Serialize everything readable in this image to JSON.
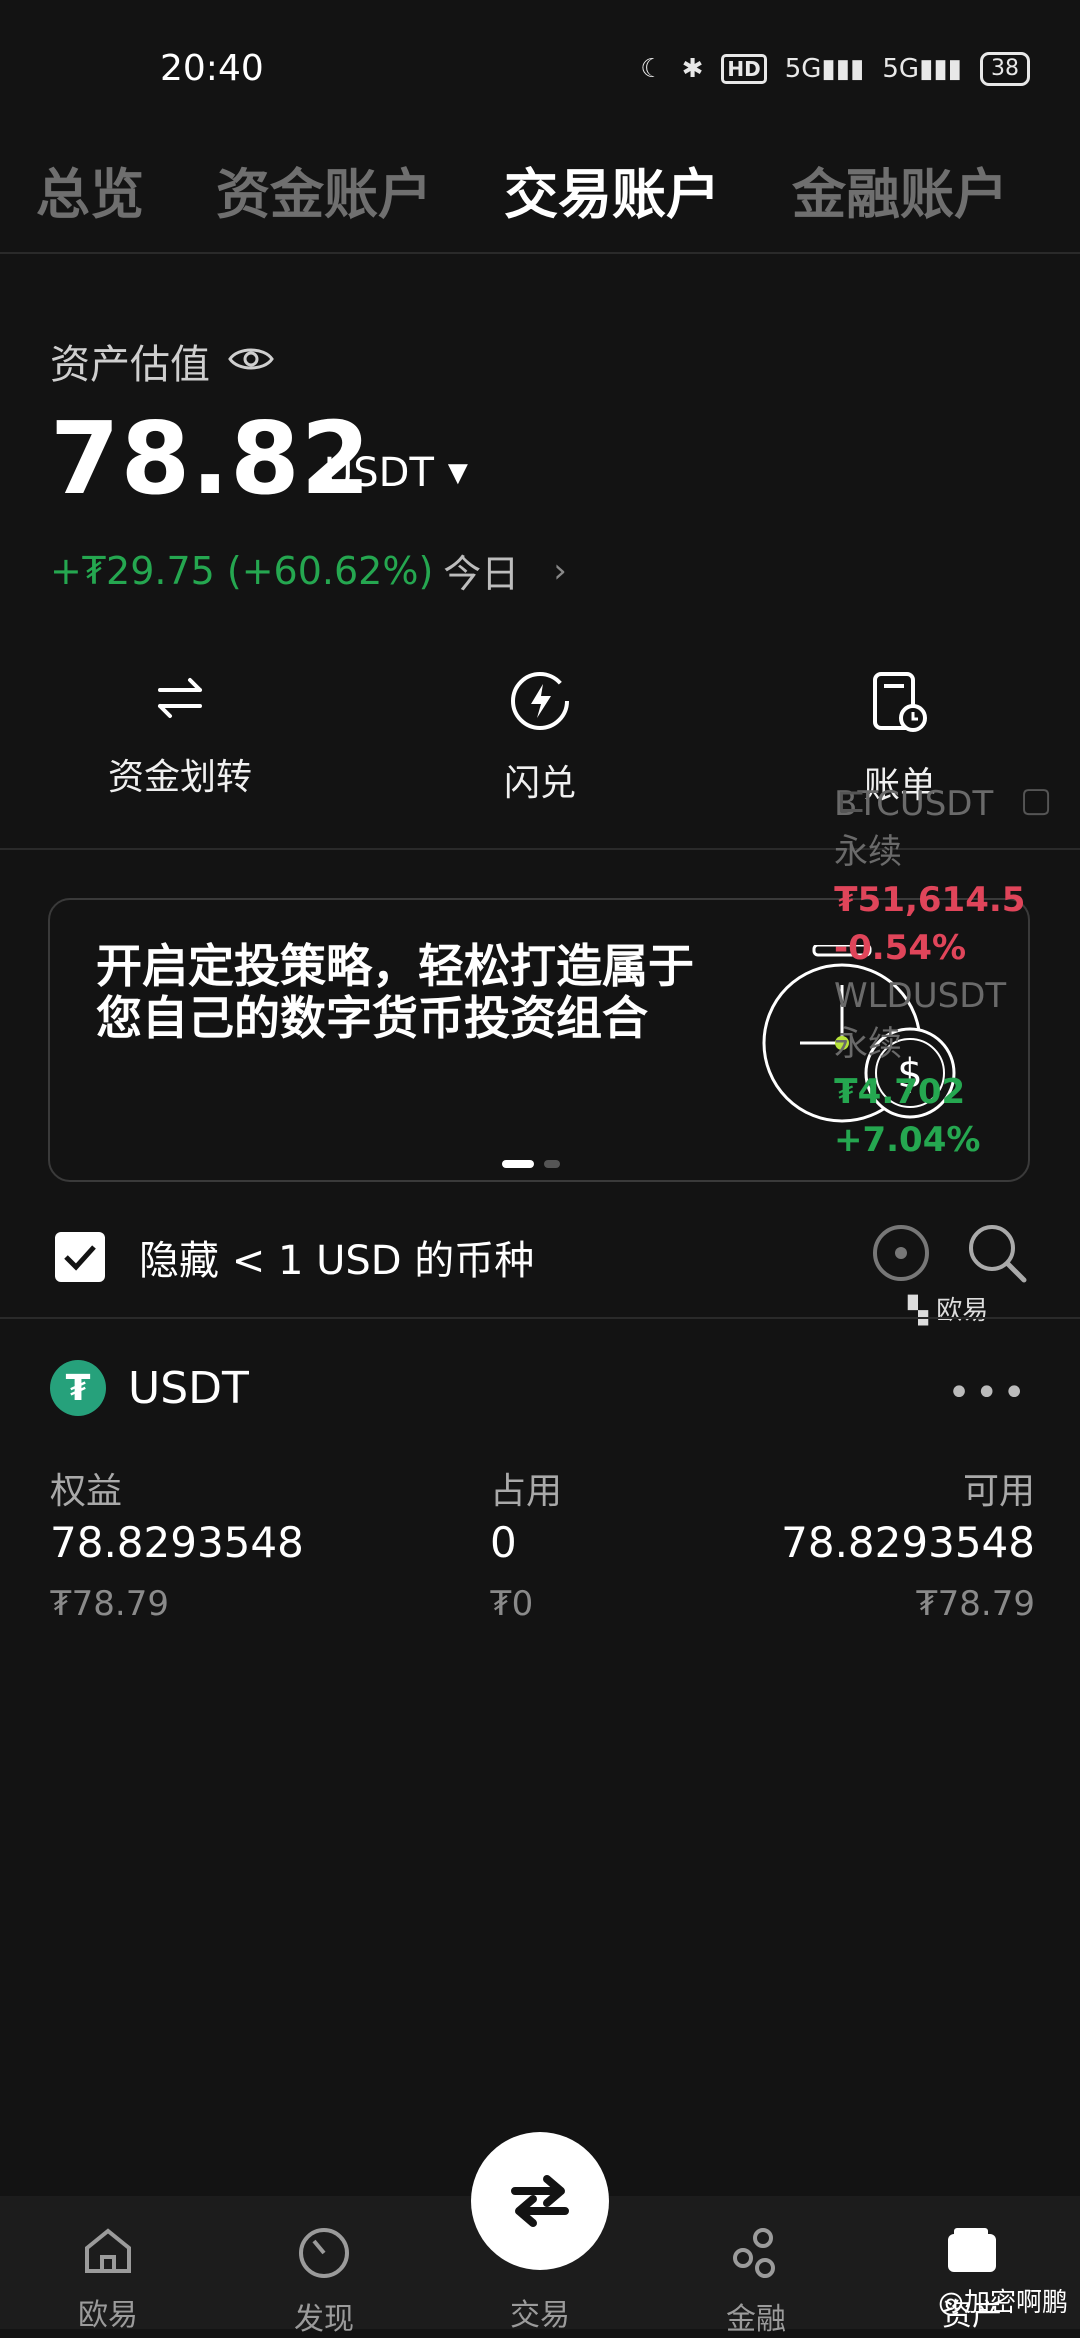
{
  "status_bar": {
    "time": "20:40",
    "battery": "38",
    "signal1": "5G",
    "signal2": "5G",
    "hd": "HD"
  },
  "tabs": [
    {
      "label": "总览"
    },
    {
      "label": "资金账户"
    },
    {
      "label": "交易账户"
    },
    {
      "label": "金融账户"
    }
  ],
  "active_tab": "交易账户",
  "asset": {
    "label": "资产估值",
    "value": "78.82",
    "unit": "USDT",
    "pnl": "+₮29.75 (+60.62%)",
    "pnl_period": "今日"
  },
  "actions": [
    {
      "label": "资金划转",
      "icon": "transfer-icon"
    },
    {
      "label": "闪兑",
      "icon": "flash-icon"
    },
    {
      "label": "账单",
      "icon": "bill-icon"
    }
  ],
  "banner": {
    "text": "开启定投策略，轻松打造属于您自己的数字货币投资组合"
  },
  "overlay": {
    "item1_name": "BTCUSDT",
    "item1_type": "永续",
    "item1_price": "₮51,614.5",
    "item1_change": "-0.54%",
    "item2_name": "WLDUSDT",
    "item2_type": "永续",
    "item2_price": "₮4.702",
    "item2_change": "+7.04%",
    "brand": "欧易"
  },
  "hide_small": {
    "label": "隐藏 < 1 USD 的币种",
    "checked": true
  },
  "coin": {
    "symbol": "USDT",
    "headers": {
      "equity": "权益",
      "used": "占用",
      "available": "可用"
    },
    "values": {
      "equity": "78.8293548",
      "used": "0",
      "available": "78.8293548"
    },
    "sub": {
      "equity": "₮78.79",
      "used": "₮0",
      "available": "₮78.79"
    }
  },
  "bottom_nav": [
    {
      "label": "欧易",
      "icon": "home-icon"
    },
    {
      "label": "发现",
      "icon": "discover-icon"
    },
    {
      "label": "交易",
      "icon": "trade-icon"
    },
    {
      "label": "金融",
      "icon": "finance-icon"
    },
    {
      "label": "资产",
      "icon": "wallet-icon"
    }
  ],
  "watermark": "@加密啊鹏"
}
